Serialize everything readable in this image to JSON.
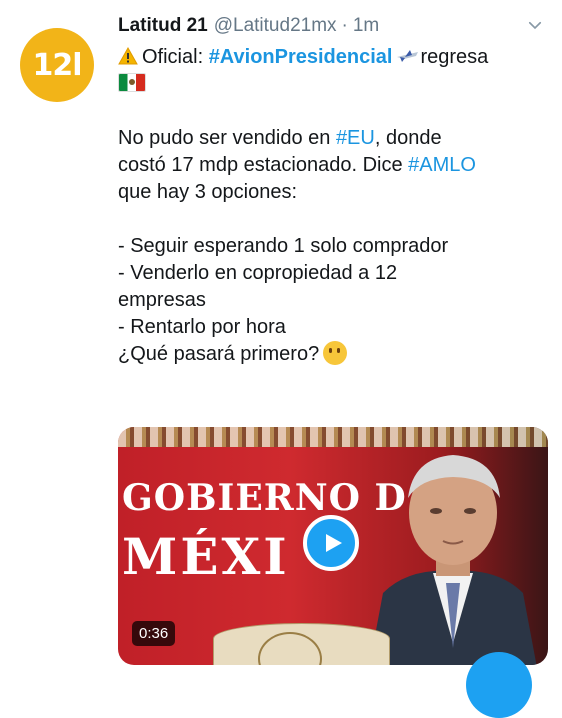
{
  "avatar": {
    "text": "12l",
    "color": "#f2b418"
  },
  "tweet": {
    "author_name": "Latitud 21",
    "handle": "@Latitud21mx",
    "separator": "·",
    "time": "1m",
    "line1_prefix": "Oficial: ",
    "line1_hashtag": "#AvionPresidencial",
    "line1_suffix": "regresa",
    "para2_a": "No pudo ser vendido en ",
    "para2_hashtag_eu": "#EU",
    "para2_b": ", donde",
    "para2_line2_a": "costó 17 mdp estacionado. Dice ",
    "para2_hashtag_amlo": "#AMLO",
    "para2_line3": "que hay 3 opciones:",
    "option1": "- Seguir esperando 1 solo comprador",
    "option2_line1": "- Venderlo en copropiedad a 12",
    "option2_line2": "empresas",
    "option3": "- Rentarlo por hora",
    "question": "¿Qué pasará primero?"
  },
  "media": {
    "backdrop_line1": "GOBIERNO D",
    "backdrop_line2": "MÉXI",
    "duration": "0:36"
  },
  "icons": {
    "warning": "warning-icon",
    "plane": "airplane-icon",
    "flag": "mexico-flag-icon",
    "thinking": "thinking-face-icon",
    "play": "play-icon",
    "more": "chevron-down-icon"
  },
  "colors": {
    "link": "#1b95e0",
    "play_button": "#1da1f2"
  }
}
